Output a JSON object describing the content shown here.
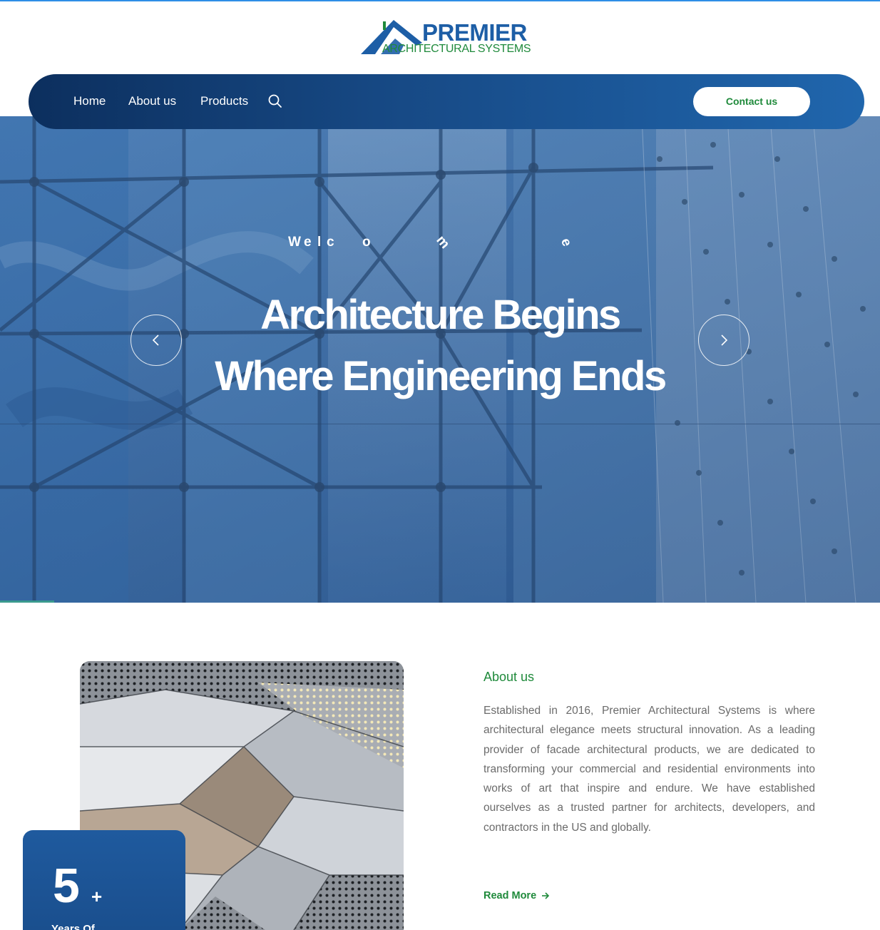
{
  "logo": {
    "title": "PREMIER",
    "subtitle": "ARCHITECTURAL SYSTEMS"
  },
  "nav": {
    "items": [
      {
        "label": "Home"
      },
      {
        "label": "About us"
      },
      {
        "label": "Products"
      }
    ],
    "search_icon": "search-icon",
    "contact_label": "Contact us"
  },
  "hero": {
    "welcome_letters": [
      "W",
      "e",
      "l",
      "c",
      "o",
      "m",
      "e"
    ],
    "title": "Architecture Begins Where Engineering Ends",
    "prev_icon": "chevron-left-icon",
    "next_icon": "chevron-right-icon"
  },
  "stat": {
    "number": "5",
    "suffix": "+",
    "label": "Years Of"
  },
  "about": {
    "heading": "About us",
    "body": "Established in 2016, Premier Architectural Systems is where architectural elegance meets structural innovation. As a leading provider of facade architectural products, we are dedicated to transforming your commercial and residential environments into works of art that inspire and endure. We have established ourselves as a trusted partner for architects, developers, and contractors in the US and globally.",
    "read_more": "Read More",
    "read_more_icon": "arrow-right-icon"
  },
  "colors": {
    "brand_blue": "#1d5ea6",
    "brand_green": "#1f8a3b",
    "nav_dark": "#0c2f5e",
    "nav_light": "#2066ad"
  }
}
